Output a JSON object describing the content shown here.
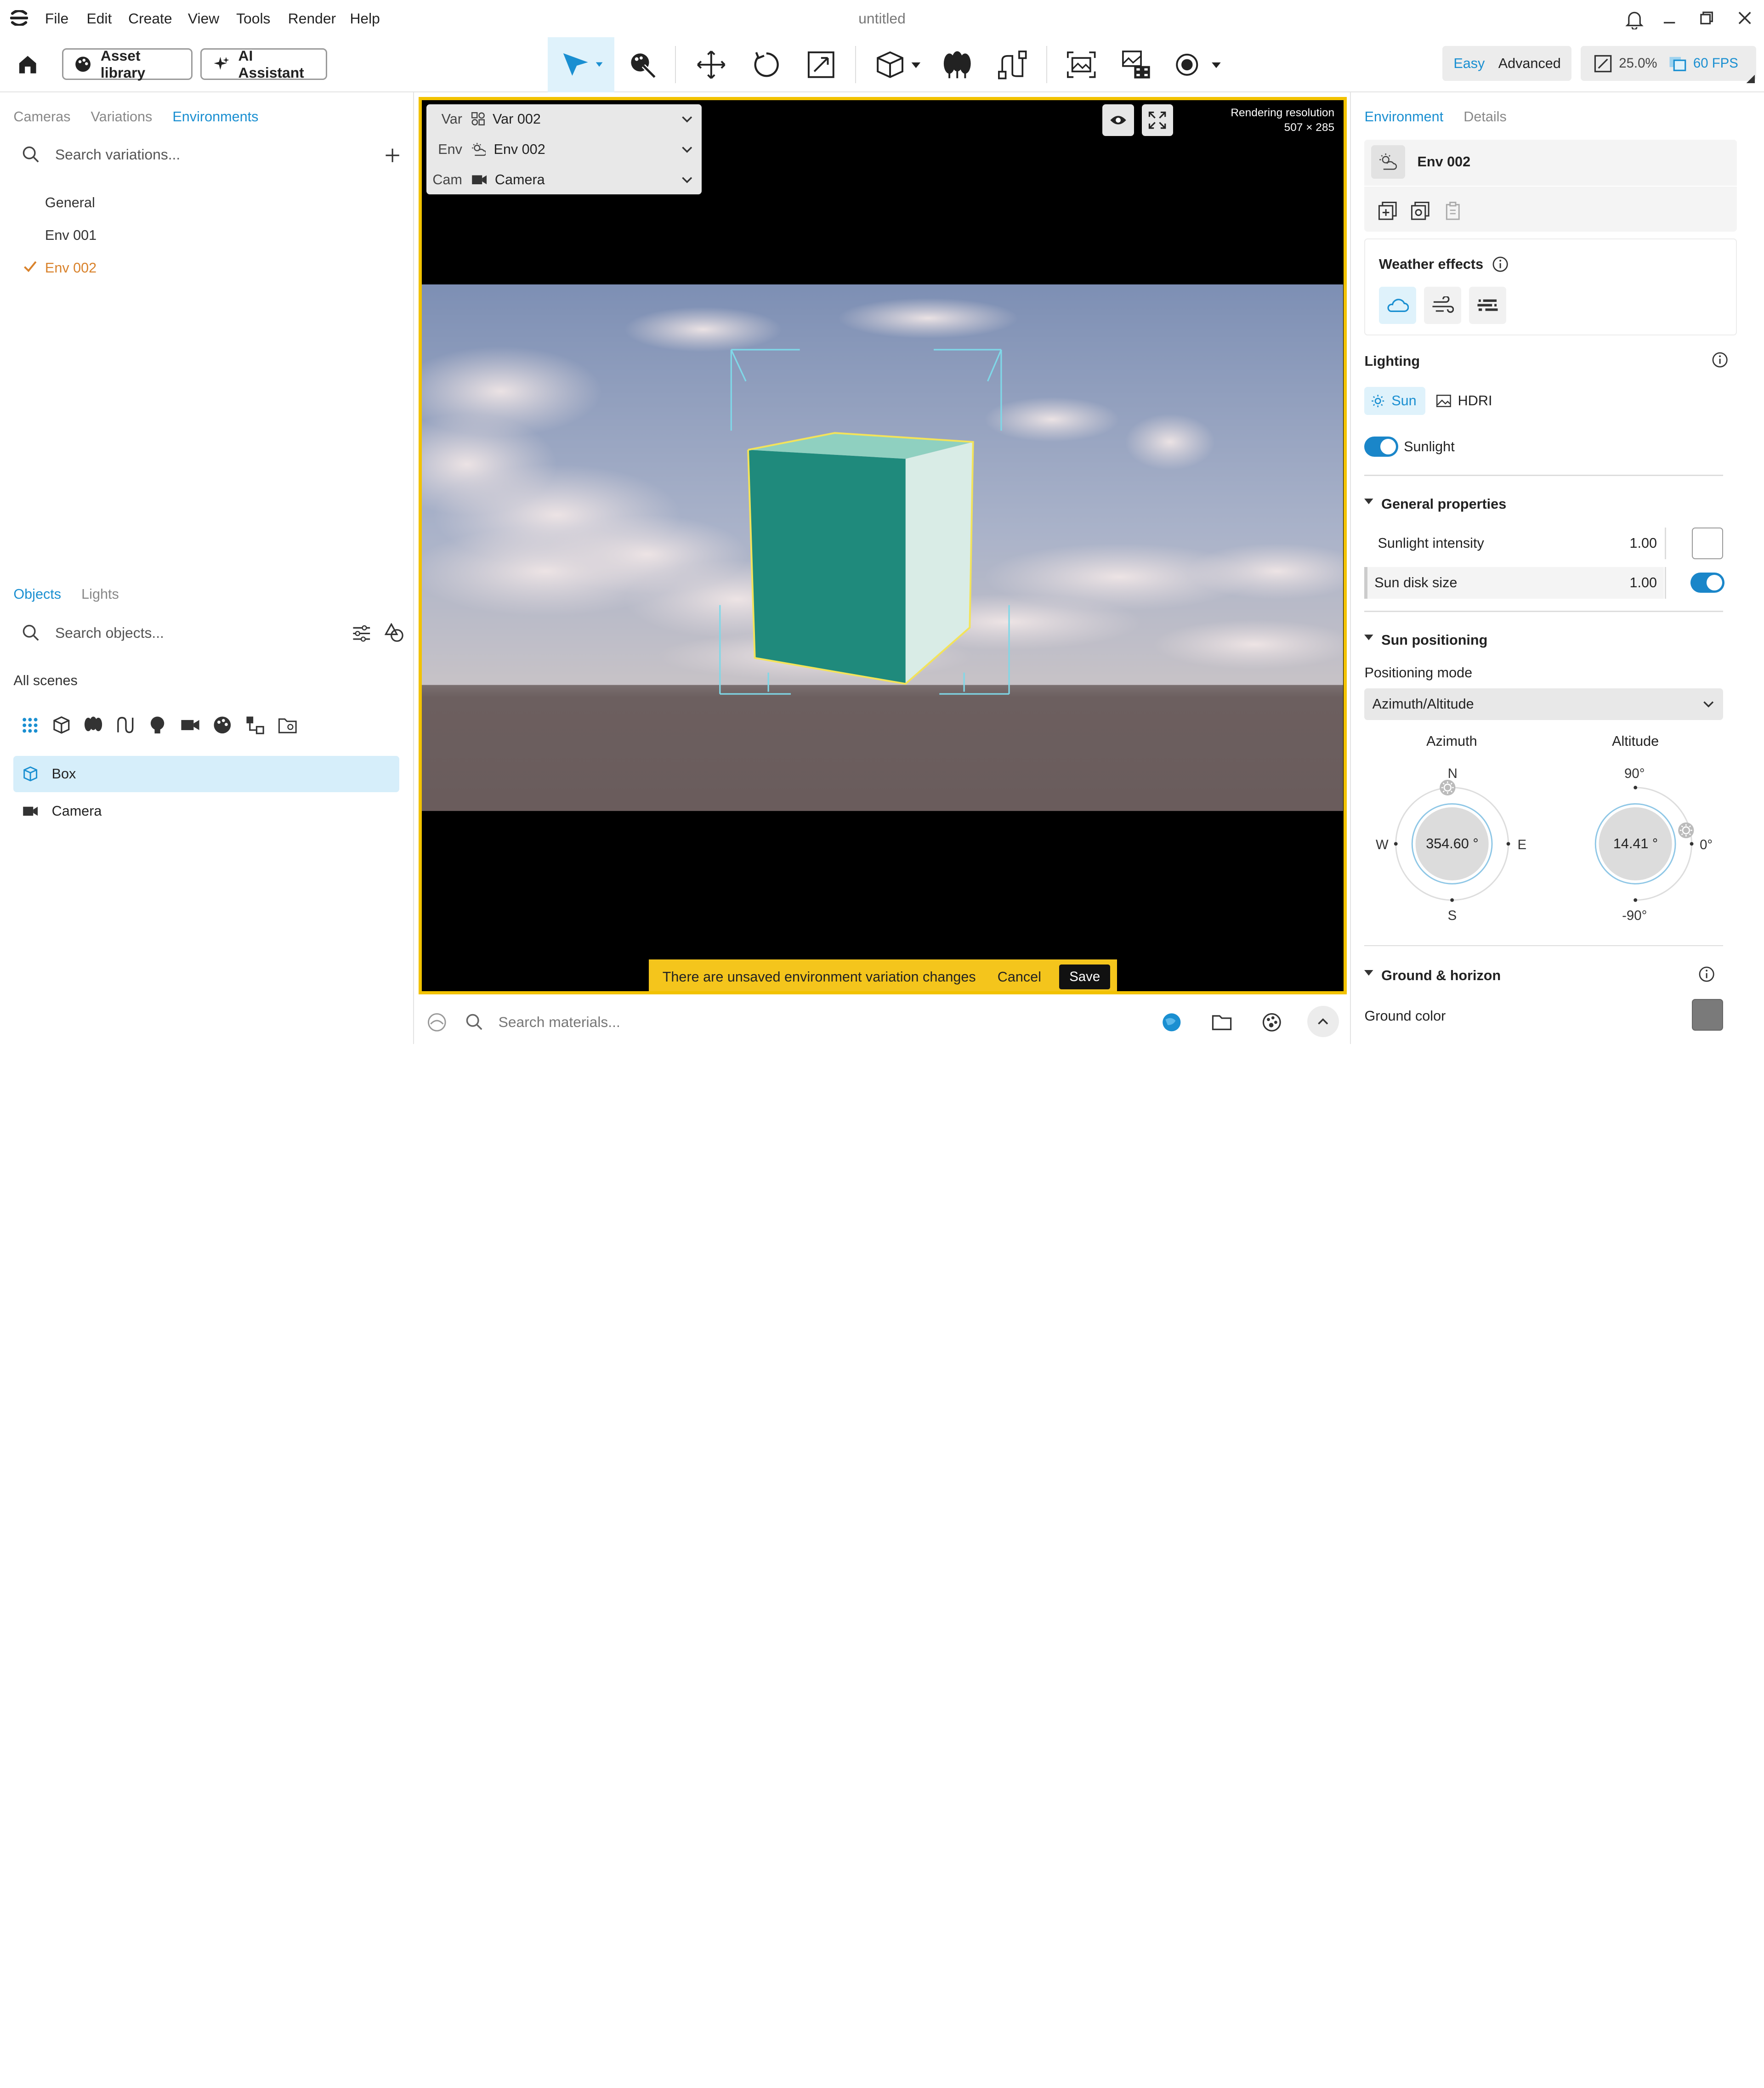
{
  "window": {
    "title": "untitled",
    "menu": [
      "File",
      "Edit",
      "Create",
      "View",
      "Tools",
      "Render",
      "Help"
    ]
  },
  "toolbar": {
    "asset_library": "Asset library",
    "ai_assistant": "AI Assistant",
    "mode_easy": "Easy",
    "mode_advanced": "Advanced",
    "zoom": "25.0%",
    "fps": "60 FPS"
  },
  "left_panel": {
    "tabs": [
      "Cameras",
      "Variations",
      "Environments"
    ],
    "active_tab": "Environments",
    "search_placeholder": "Search variations...",
    "items": [
      "General",
      "Env 001",
      "Env 002"
    ],
    "selected_item": "Env 002"
  },
  "objects_panel": {
    "tabs": [
      "Objects",
      "Lights"
    ],
    "active_tab": "Objects",
    "search_placeholder": "Search objects...",
    "scope": "All scenes",
    "items": [
      "Box",
      "Camera"
    ],
    "selected_item": "Box"
  },
  "viewport": {
    "var_label": "Var",
    "var_value": "Var 002",
    "env_label": "Env",
    "env_value": "Env 002",
    "cam_label": "Cam",
    "cam_value": "Camera",
    "render_res_label": "Rendering resolution",
    "render_res_value": "507 × 285",
    "notification": "There are unsaved environment variation changes",
    "cancel": "Cancel",
    "save": "Save"
  },
  "material_bar": {
    "search_placeholder": "Search materials..."
  },
  "right_panel": {
    "tabs": [
      "Environment",
      "Details"
    ],
    "active_tab": "Environment",
    "env_name": "Env 002",
    "weather_title": "Weather effects",
    "lighting_title": "Lighting",
    "lighting_sun": "Sun",
    "lighting_hdri": "HDRI",
    "sunlight_label": "Sunlight",
    "general_title": "General properties",
    "sunlight_intensity_label": "Sunlight intensity",
    "sunlight_intensity_value": "1.00",
    "sun_disk_label": "Sun disk size",
    "sun_disk_value": "1.00",
    "sun_positioning_title": "Sun positioning",
    "positioning_mode_label": "Positioning mode",
    "positioning_mode_value": "Azimuth/Altitude",
    "azimuth_label": "Azimuth",
    "azimuth_value": "354.60 °",
    "altitude_label": "Altitude",
    "altitude_value": "14.41 °",
    "compass": {
      "n": "N",
      "s": "S",
      "e": "E",
      "w": "W"
    },
    "altitude_marks": {
      "top": "90°",
      "mid": "0°",
      "bottom": "-90°"
    },
    "ground_title": "Ground & horizon",
    "ground_color_label": "Ground color"
  },
  "colors": {
    "accent": "#1a8fd1",
    "selected_orange": "#d9822b",
    "viewport_border": "#f2c200",
    "banner": "#f4c51c",
    "cube_front": "#1f8a7c",
    "cube_side": "#d9ece6",
    "cube_top": "#8fd0c0",
    "ground_color": "#7a7a7a"
  }
}
